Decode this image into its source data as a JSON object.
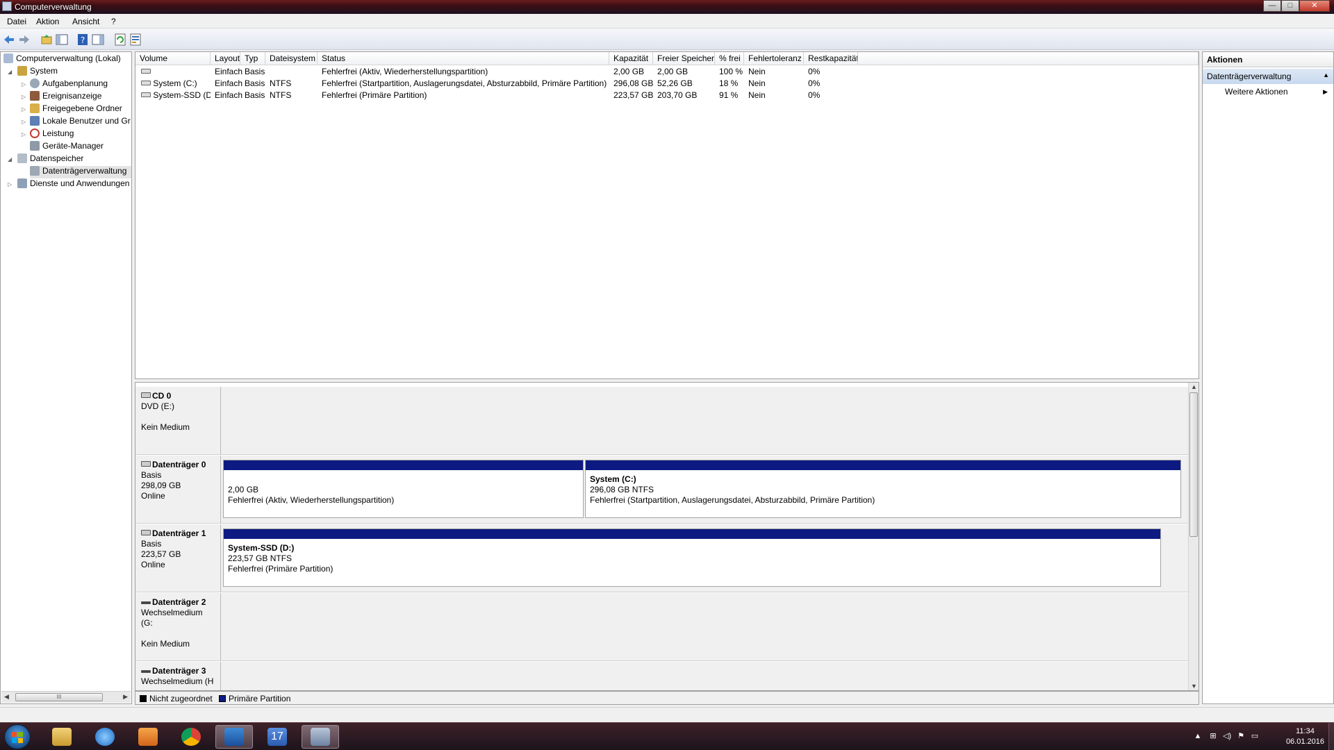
{
  "window": {
    "title": "Computerverwaltung",
    "buttons": {
      "minimize": "—",
      "maximize": "□",
      "close": "✕"
    }
  },
  "menu": [
    "Datei",
    "Aktion",
    "Ansicht",
    "?"
  ],
  "tree": {
    "root": "Computerverwaltung (Lokal)",
    "system": "System",
    "aufgaben": "Aufgabenplanung",
    "ereignis": "Ereignisanzeige",
    "freigabe": "Freigegebene Ordner",
    "lokal": "Lokale Benutzer und Gr",
    "leistung": "Leistung",
    "geraete": "Geräte-Manager",
    "datenspeicher": "Datenspeicher",
    "datentraeger": "Datenträgerverwaltung",
    "dienste": "Dienste und Anwendungen",
    "scroll_thumb": "III"
  },
  "table": {
    "headers": [
      "Volume",
      "Layout",
      "Typ",
      "Dateisystem",
      "Status",
      "Kapazität",
      "Freier Speicher",
      "% frei",
      "Fehlertoleranz",
      "Restkapazität"
    ],
    "rows": [
      [
        "",
        "Einfach",
        "Basis",
        "",
        "Fehlerfrei (Aktiv, Wiederherstellungspartition)",
        "2,00 GB",
        "2,00 GB",
        "100 %",
        "Nein",
        "0%"
      ],
      [
        "System (C:)",
        "Einfach",
        "Basis",
        "NTFS",
        "Fehlerfrei (Startpartition, Auslagerungsdatei, Absturzabbild, Primäre Partition)",
        "296,08 GB",
        "52,26 GB",
        "18 %",
        "Nein",
        "0%"
      ],
      [
        "System-SSD (D:)",
        "Einfach",
        "Basis",
        "NTFS",
        "Fehlerfrei (Primäre Partition)",
        "223,57 GB",
        "203,70 GB",
        "91 %",
        "Nein",
        "0%"
      ]
    ]
  },
  "disks": {
    "cd0": {
      "name": "CD 0",
      "l1": "DVD (E:)",
      "l2": "",
      "l3": "Kein Medium"
    },
    "d0": {
      "name": "Datenträger 0",
      "l1": "Basis",
      "l2": "298,09 GB",
      "l3": "Online",
      "p1": {
        "title": "",
        "size": "2,00 GB",
        "status": "Fehlerfrei (Aktiv, Wiederherstellungspartition)"
      },
      "p2": {
        "title": "System  (C:)",
        "size": "296,08 GB NTFS",
        "status": "Fehlerfrei (Startpartition, Auslagerungsdatei, Absturzabbild, Primäre Partition)"
      }
    },
    "d1": {
      "name": "Datenträger 1",
      "l1": "Basis",
      "l2": "223,57 GB",
      "l3": "Online",
      "p1": {
        "title": "System-SSD  (D:)",
        "size": "223,57 GB NTFS",
        "status": "Fehlerfrei (Primäre Partition)"
      }
    },
    "d2": {
      "name": "Datenträger 2",
      "l1": "Wechselmedium (G:",
      "l2": "",
      "l3": "Kein Medium"
    },
    "d3": {
      "name": "Datenträger 3",
      "l1": "Wechselmedium (H",
      "l2": "",
      "l3": ""
    }
  },
  "legend": {
    "unallocated": "Nicht zugeordnet",
    "primary": "Primäre Partition",
    "unallocated_color": "#000000",
    "primary_color": "#0d1a82"
  },
  "actions": {
    "header": "Aktionen",
    "section": "Datenträgerverwaltung",
    "item": "Weitere Aktionen"
  },
  "taskbar": {
    "time": "11:34",
    "date": "06.01.2016",
    "calendar_day": "17"
  }
}
